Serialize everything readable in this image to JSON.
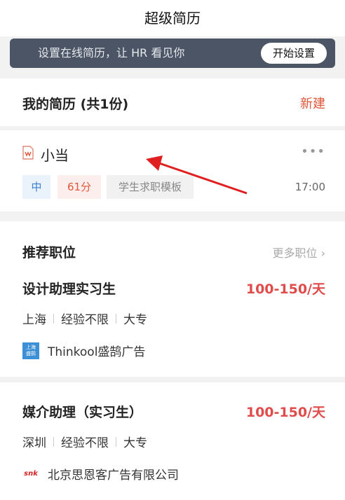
{
  "header": {
    "title": "超级简历"
  },
  "banner": {
    "text": "设置在线简历，让 HR 看见你",
    "button": "开始设置"
  },
  "resume_section": {
    "title": "我的简历 (共1份)",
    "new_label": "新建"
  },
  "resume": {
    "name": "小当",
    "more": "•••",
    "level": "中",
    "score": "61分",
    "template": "学生求职模板",
    "time": "17:00"
  },
  "jobs_section": {
    "title": "推荐职位",
    "more_label": "更多职位 ›"
  },
  "jobs": [
    {
      "title": "设计助理实习生",
      "salary": "100-150/天",
      "city": "上海",
      "experience": "经验不限",
      "education": "大专",
      "company": "Thinkool盛鹄广告",
      "logo_text": "上海\n盛鹄"
    },
    {
      "title": "媒介助理（实习生）",
      "salary": "100-150/天",
      "city": "深圳",
      "experience": "经验不限",
      "education": "大专",
      "company": "北京思恩客广告有限公司",
      "logo_text": "snk"
    }
  ],
  "colors": {
    "accent": "#e0573a",
    "salary": "#e04b4b",
    "banner_bg": "#4b5566",
    "arrow": "#e02020"
  }
}
